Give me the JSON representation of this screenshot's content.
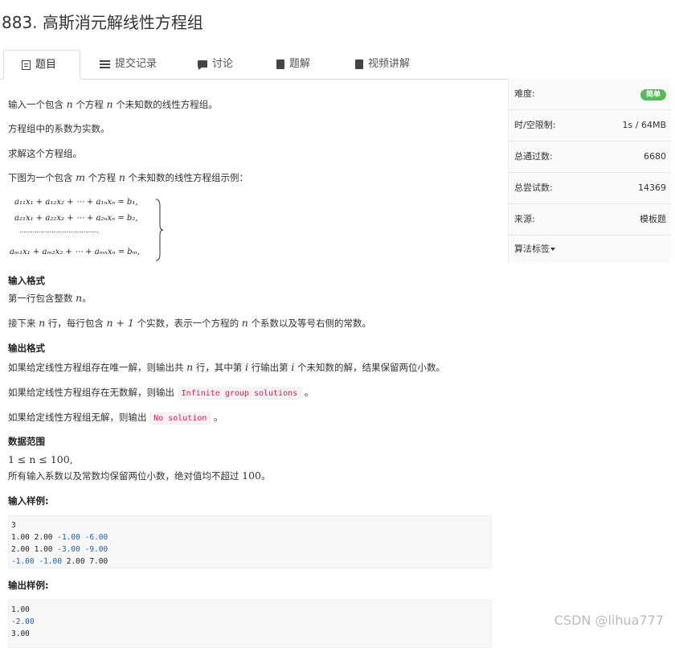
{
  "title": "883. 高斯消元解线性方程组",
  "tabs": [
    {
      "label": "题目",
      "icon": "document-icon"
    },
    {
      "label": "提交记录",
      "icon": "list-icon"
    },
    {
      "label": "讨论",
      "icon": "comment-icon"
    },
    {
      "label": "题解",
      "icon": "book-icon"
    },
    {
      "label": "视频讲解",
      "icon": "book-icon"
    }
  ],
  "body": {
    "p1_pre": "输入一个包含 ",
    "p1_n1": "n",
    "p1_mid": " 个方程 ",
    "p1_n2": "n",
    "p1_post": " 个未知数的线性方程组。",
    "p2": "方程组中的系数为实数。",
    "p3": "求解这个方程组。",
    "p4_pre": "下图为一个包含 ",
    "p4_m": "m",
    "p4_mid": " 个方程 ",
    "p4_n": "n",
    "p4_post": " 个未知数的线性方程组示例：",
    "eq_lines": [
      "a₁₁x₁ + a₁₂x₂ + ⋯ + a₁ₙxₙ = b₁,",
      "a₂₁x₁ + a₂₂x₂ + ⋯ + a₂ₙxₙ = b₂,",
      "⋯⋯⋯⋯⋯⋯⋯⋯⋯⋯⋯⋯⋯⋯",
      "aₘ₁x₁ + aₘ₂x₂ + ⋯ + aₘₙxₙ = bₘ,"
    ]
  },
  "input_format": {
    "heading": "输入格式",
    "l1_pre": "第一行包含整数 ",
    "l1_n": "n",
    "l1_post": "。",
    "l2_pre": "接下来 ",
    "l2_n1": "n",
    "l2_mid1": " 行，每行包含 ",
    "l2_expr": "n + 1",
    "l2_mid2": " 个实数，表示一个方程的 ",
    "l2_n2": "n",
    "l2_post": " 个系数以及等号右侧的常数。"
  },
  "output_format": {
    "heading": "输出格式",
    "l1_pre": "如果给定线性方程组存在唯一解，则输出共 ",
    "l1_n": "n",
    "l1_mid1": " 行，其中第 ",
    "l1_i1": "i",
    "l1_mid2": " 行输出第 ",
    "l1_i2": "i",
    "l1_post": " 个未知数的解，结果保留两位小数。",
    "l2_pre": "如果给定线性方程组存在无数解，则输出 ",
    "l2_code": "Infinite group solutions",
    "l2_post": " 。",
    "l3_pre": "如果给定线性方程组无解，则输出 ",
    "l3_code": "No solution",
    "l3_post": " 。"
  },
  "range": {
    "heading": "数据范围",
    "l1": "1 ≤ n ≤ 100,",
    "l2_pre": "所有输入系数以及常数均保留两位小数，绝对值均不超过 ",
    "l2_num": "100",
    "l2_post": "。"
  },
  "sample_input": {
    "heading": "输入样例:",
    "lines": [
      "3",
      "1.00 2.00 -1.00 -6.00",
      "2.00 1.00 -3.00 -9.00",
      "-1.00 -1.00 2.00 7.00"
    ]
  },
  "sample_output": {
    "heading": "输出样例:",
    "lines": [
      "1.00",
      "-2.00",
      "3.00"
    ]
  },
  "sidebar": {
    "difficulty_label": "难度:",
    "difficulty_value": "简单",
    "limit_label": "时/空限制:",
    "limit_value": "1s / 64MB",
    "passed_label": "总通过数:",
    "passed_value": "6680",
    "attempts_label": "总尝试数:",
    "attempts_value": "14369",
    "source_label": "来源:",
    "source_value": "模板题",
    "tags_label": "算法标签"
  },
  "watermark": "CSDN @lihua777",
  "colors": {
    "badge": "#5cb85c",
    "code_text": "#c7254e",
    "number_blue": "#1a5fb4"
  }
}
